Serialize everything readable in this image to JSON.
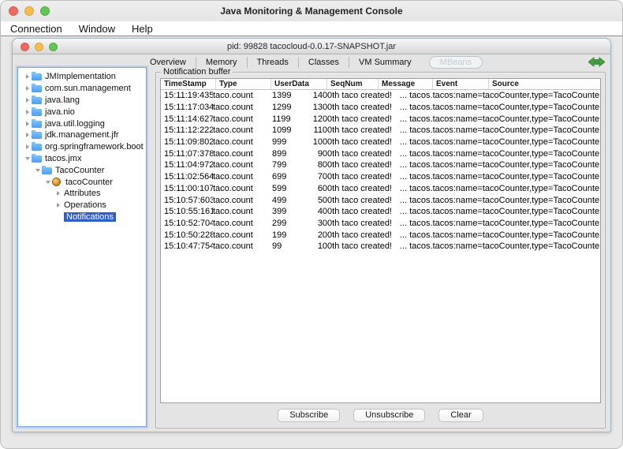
{
  "window": {
    "title": "Java Monitoring & Management Console"
  },
  "menu_bar": {
    "items": [
      "Connection",
      "Window",
      "Help"
    ]
  },
  "inner_window": {
    "title": "pid: 99828 tacocloud-0.0.17-SNAPSHOT.jar"
  },
  "tabs": {
    "items": [
      {
        "label": "Overview",
        "selected": false
      },
      {
        "label": "Memory",
        "selected": false
      },
      {
        "label": "Threads",
        "selected": false
      },
      {
        "label": "Classes",
        "selected": false
      },
      {
        "label": "VM Summary",
        "selected": false
      },
      {
        "label": "MBeans",
        "selected": true
      }
    ]
  },
  "connection_icon": "green-plug-connected",
  "tree": {
    "items": [
      {
        "label": "JMImplementation",
        "depth": 0,
        "icon": "folder",
        "expand": "collapsed",
        "selected": false
      },
      {
        "label": "com.sun.management",
        "depth": 0,
        "icon": "folder",
        "expand": "collapsed",
        "selected": false
      },
      {
        "label": "java.lang",
        "depth": 0,
        "icon": "folder",
        "expand": "collapsed",
        "selected": false
      },
      {
        "label": "java.nio",
        "depth": 0,
        "icon": "folder",
        "expand": "collapsed",
        "selected": false
      },
      {
        "label": "java.util.logging",
        "depth": 0,
        "icon": "folder",
        "expand": "collapsed",
        "selected": false
      },
      {
        "label": "jdk.management.jfr",
        "depth": 0,
        "icon": "folder",
        "expand": "collapsed",
        "selected": false
      },
      {
        "label": "org.springframework.boot",
        "depth": 0,
        "icon": "folder",
        "expand": "collapsed",
        "selected": false
      },
      {
        "label": "tacos.jmx",
        "depth": 0,
        "icon": "folder",
        "expand": "expanded",
        "selected": false
      },
      {
        "label": "TacoCounter",
        "depth": 1,
        "icon": "folder",
        "expand": "expanded",
        "selected": false
      },
      {
        "label": "tacoCounter",
        "depth": 2,
        "icon": "bean",
        "expand": "expanded",
        "selected": false
      },
      {
        "label": "Attributes",
        "depth": 3,
        "icon": "none",
        "expand": "collapsed",
        "selected": false
      },
      {
        "label": "Operations",
        "depth": 3,
        "icon": "none",
        "expand": "collapsed",
        "selected": false
      },
      {
        "label": "Notifications",
        "depth": 3,
        "icon": "none",
        "expand": "none",
        "selected": true
      }
    ]
  },
  "notification_panel": {
    "title": "Notification buffer",
    "table": {
      "headers": [
        "TimeStamp",
        "Type",
        "UserData",
        "SeqNum",
        "Message",
        "Event",
        "Source"
      ],
      "source_text": "... tacos.tacos:name=tacoCounter,type=TacoCounte...",
      "rows": [
        {
          "timestamp": "15:11:19:435",
          "type": "taco.count",
          "user_data": "1399",
          "message": "1400th taco created!"
        },
        {
          "timestamp": "15:11:17:034",
          "type": "taco.count",
          "user_data": "1299",
          "message": "1300th taco created!"
        },
        {
          "timestamp": "15:11:14:627",
          "type": "taco.count",
          "user_data": "1199",
          "message": "1200th taco created!"
        },
        {
          "timestamp": "15:11:12:222",
          "type": "taco.count",
          "user_data": "1099",
          "message": "1100th taco created!"
        },
        {
          "timestamp": "15:11:09:802",
          "type": "taco.count",
          "user_data": "999",
          "message": "1000th taco created!"
        },
        {
          "timestamp": "15:11:07:378",
          "type": "taco.count",
          "user_data": "899",
          "message": "900th taco created!"
        },
        {
          "timestamp": "15:11:04:972",
          "type": "taco.count",
          "user_data": "799",
          "message": "800th taco created!"
        },
        {
          "timestamp": "15:11:02:564",
          "type": "taco.count",
          "user_data": "699",
          "message": "700th taco created!"
        },
        {
          "timestamp": "15:11:00:107",
          "type": "taco.count",
          "user_data": "599",
          "message": "600th taco created!"
        },
        {
          "timestamp": "15:10:57:603",
          "type": "taco.count",
          "user_data": "499",
          "message": "500th taco created!"
        },
        {
          "timestamp": "15:10:55:161",
          "type": "taco.count",
          "user_data": "399",
          "message": "400th taco created!"
        },
        {
          "timestamp": "15:10:52:704",
          "type": "taco.count",
          "user_data": "299",
          "message": "300th taco created!"
        },
        {
          "timestamp": "15:10:50:228",
          "type": "taco.count",
          "user_data": "199",
          "message": "200th taco created!"
        },
        {
          "timestamp": "15:10:47:754",
          "type": "taco.count",
          "user_data": "99",
          "message": "100th taco created!"
        }
      ]
    },
    "buttons": [
      "Subscribe",
      "Unsubscribe",
      "Clear"
    ]
  },
  "colors": {
    "selection_blue": "#2e5fc7",
    "focus_ring_blue": "#b9d2f0",
    "folder_blue": "#4f9df0",
    "bean_amber": "#d98f2b",
    "connected_green": "#3f9e3f",
    "traffic_red": "#ee6a5f",
    "traffic_yellow": "#f5bd4f",
    "traffic_green": "#61c454"
  }
}
